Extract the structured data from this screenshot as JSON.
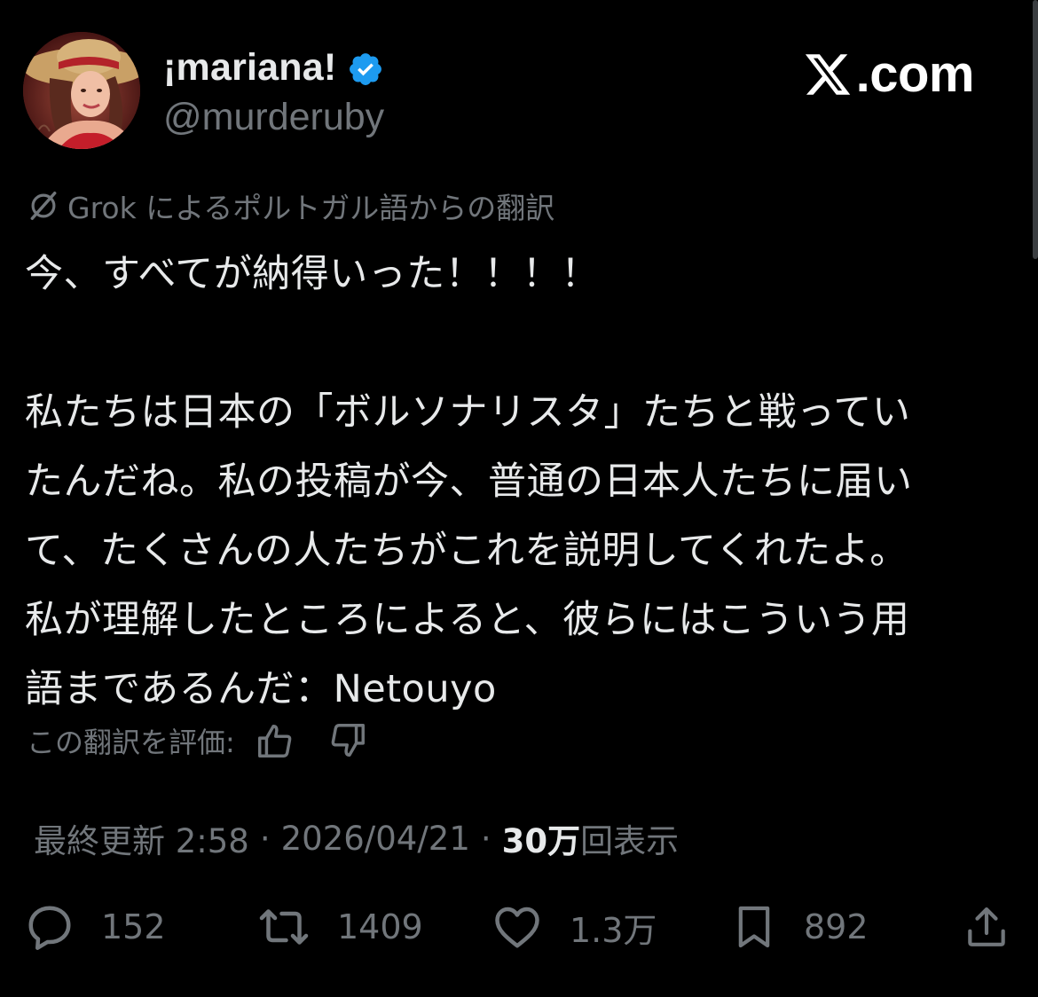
{
  "user": {
    "display_name": "¡mariana!",
    "handle": "@murderuby",
    "verified": true
  },
  "brand": {
    "text": ".com",
    "logo": "x-logo"
  },
  "translation": {
    "label": "Grok によるポルトガル語からの翻訳",
    "icon": "grok-icon"
  },
  "tweet": {
    "lines": [
      "今、すべてが納得いった！！！！",
      "",
      "私たちは日本の「ボルソナリスタ」たちと戦ってい",
      "たんだね。私の投稿が今、普通の日本人たちに届い",
      "て、たくさんの人たちがこれを説明してくれたよ。",
      "私が理解したところによると、彼らにはこういう用",
      "語まであるんだ：Netouyo"
    ]
  },
  "rate": {
    "label": "この翻訳を評価:",
    "up_icon": "thumbs-up-icon",
    "down_icon": "thumbs-down-icon"
  },
  "meta": {
    "updated_label": "最終更新 2:58",
    "sep1": "·",
    "date": "2026/04/21",
    "sep2": "·",
    "views_count": "30万",
    "views_label": "回表示"
  },
  "actions": {
    "reply_count": "152",
    "retweet_count": "1409",
    "like_count": "1.3万",
    "bookmark_count": "892"
  },
  "colors": {
    "background": "#000000",
    "text": "#e7e9ea",
    "muted": "#71767b",
    "verified": "#1d9bf0"
  }
}
